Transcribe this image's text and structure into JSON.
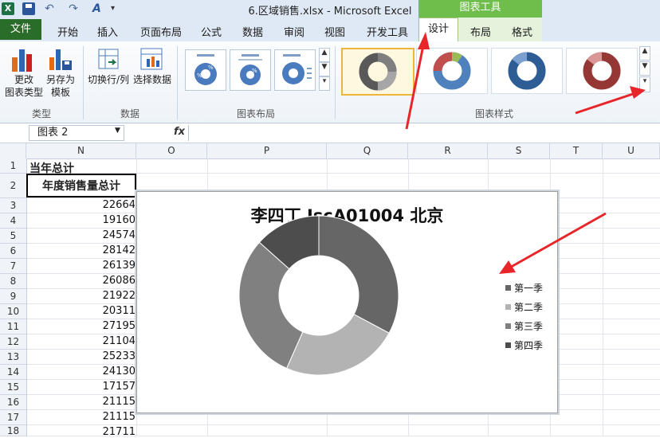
{
  "titlebar": {
    "document_title": "6.区域销售.xlsx  -  Microsoft Excel",
    "chart_tools": "图表工具"
  },
  "tabs": {
    "file": "文件",
    "home": "开始",
    "insert": "插入",
    "page_layout": "页面布局",
    "formulas": "公式",
    "data": "数据",
    "review": "审阅",
    "view": "视图",
    "developer": "开发工具",
    "design": "设计",
    "layout": "布局",
    "format": "格式"
  },
  "ribbon": {
    "change_type_1": "更改",
    "change_type_2": "图表类型",
    "save_template_1": "另存为",
    "save_template_2": "模板",
    "switch_row_col": "切换行/列",
    "select_data": "选择数据",
    "group_type": "类型",
    "group_data": "数据",
    "group_layout": "图表布局",
    "group_styles": "图表样式"
  },
  "formula_bar": {
    "name_box": "图表 2",
    "fx": "fx",
    "formula": ""
  },
  "columns": [
    "N",
    "O",
    "P",
    "Q",
    "R",
    "S",
    "T",
    "U"
  ],
  "rows": [
    "1",
    "2",
    "3",
    "4",
    "5",
    "6",
    "7",
    "8",
    "9",
    "10",
    "11",
    "12",
    "13",
    "14",
    "15",
    "16",
    "17",
    "18"
  ],
  "cells": {
    "n1": "当年总计",
    "n2": "年度销售量总计",
    "values": [
      "22664",
      "19160",
      "24574",
      "28142",
      "26139",
      "26086",
      "21922",
      "20311",
      "27195",
      "21104",
      "25233",
      "24130",
      "17157",
      "21115",
      "21115",
      "21711"
    ]
  },
  "chart_data": {
    "type": "pie",
    "variant": "doughnut",
    "title": "李四丁 JscA01004 北京",
    "categories": [
      "第一季",
      "第二季",
      "第三季",
      "第四季"
    ],
    "values": [
      5800,
      4200,
      5300,
      2364
    ],
    "colors": [
      "#666666",
      "#b3b3b3",
      "#808080",
      "#4d4d4d"
    ],
    "legend": "right"
  }
}
